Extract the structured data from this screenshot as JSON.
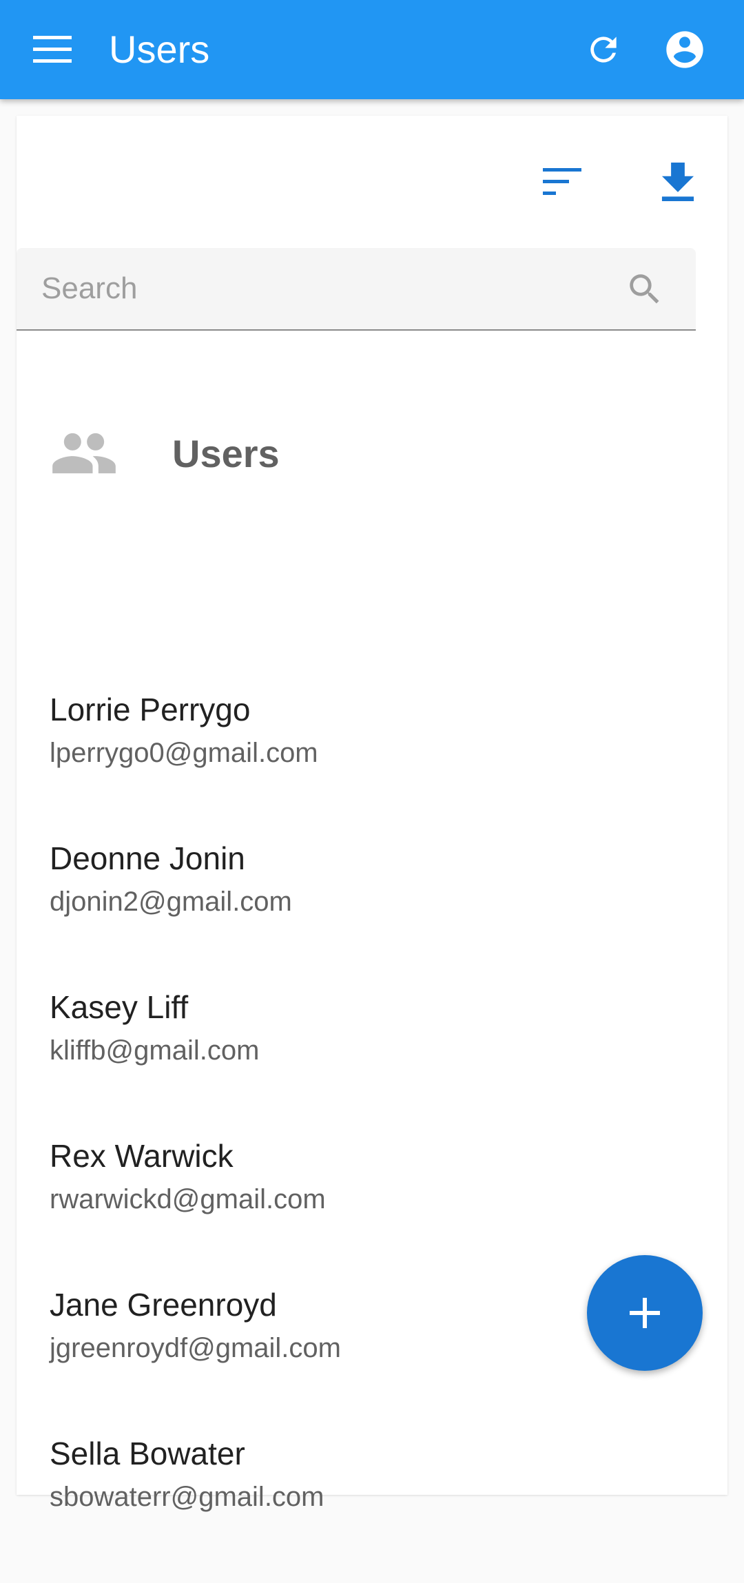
{
  "app_bar": {
    "title": "Users",
    "background_color": "#2196f3",
    "menu_icon": "menu-icon",
    "refresh_icon": "refresh-icon",
    "account_icon": "account-circle-icon"
  },
  "toolbar": {
    "sort_icon": "sort-icon",
    "download_icon": "download-icon",
    "icon_color": "#1976d2"
  },
  "search": {
    "placeholder": "Search",
    "value": "",
    "icon": "search-icon"
  },
  "section": {
    "title": "Users",
    "icon": "group-icon"
  },
  "users": [
    {
      "name": "Lorrie Perrygo",
      "email": "lperrygo0@gmail.com"
    },
    {
      "name": "Deonne Jonin",
      "email": "djonin2@gmail.com"
    },
    {
      "name": "Kasey Liff",
      "email": "kliffb@gmail.com"
    },
    {
      "name": "Rex Warwick",
      "email": "rwarwickd@gmail.com"
    },
    {
      "name": "Jane Greenroyd",
      "email": "jgreenroydf@gmail.com"
    },
    {
      "name": "Sella Bowater",
      "email": "sbowaterr@gmail.com"
    }
  ],
  "fab": {
    "icon": "add-icon",
    "color": "#1976d2"
  }
}
